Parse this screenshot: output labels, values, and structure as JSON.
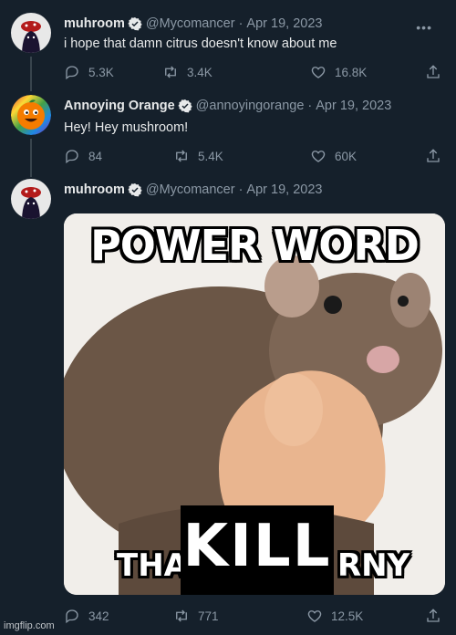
{
  "tweets": [
    {
      "name": "muhroom",
      "handle": "@Mycomancer",
      "date": "Apr 19, 2023",
      "text": "i hope that damn citrus doesn't know about me",
      "replies": "5.3K",
      "retweets": "3.4K",
      "likes": "16.8K"
    },
    {
      "name": "Annoying Orange",
      "handle": "@annoyingorange",
      "date": "Apr 19, 2023",
      "text": "Hey! Hey mushroom!",
      "replies": "84",
      "retweets": "5.4K",
      "likes": "60K"
    },
    {
      "name": "muhroom",
      "handle": "@Mycomancer",
      "date": "Apr 19, 2023",
      "text": "",
      "replies": "342",
      "retweets": "771",
      "likes": "12.5K"
    }
  ],
  "meme": {
    "top_text": "POWER WORD",
    "bottom_left": "THA",
    "bottom_center": "KILL",
    "bottom_right": "RNY"
  },
  "watermark": "imgflip.com",
  "colors": {
    "background": "#15202b",
    "text": "#e7e9ea",
    "muted": "#8b98a5",
    "verified": "#1d9bf0"
  },
  "icons": [
    "reply-icon",
    "retweet-icon",
    "like-icon",
    "share-icon",
    "verified-icon",
    "more-icon"
  ]
}
